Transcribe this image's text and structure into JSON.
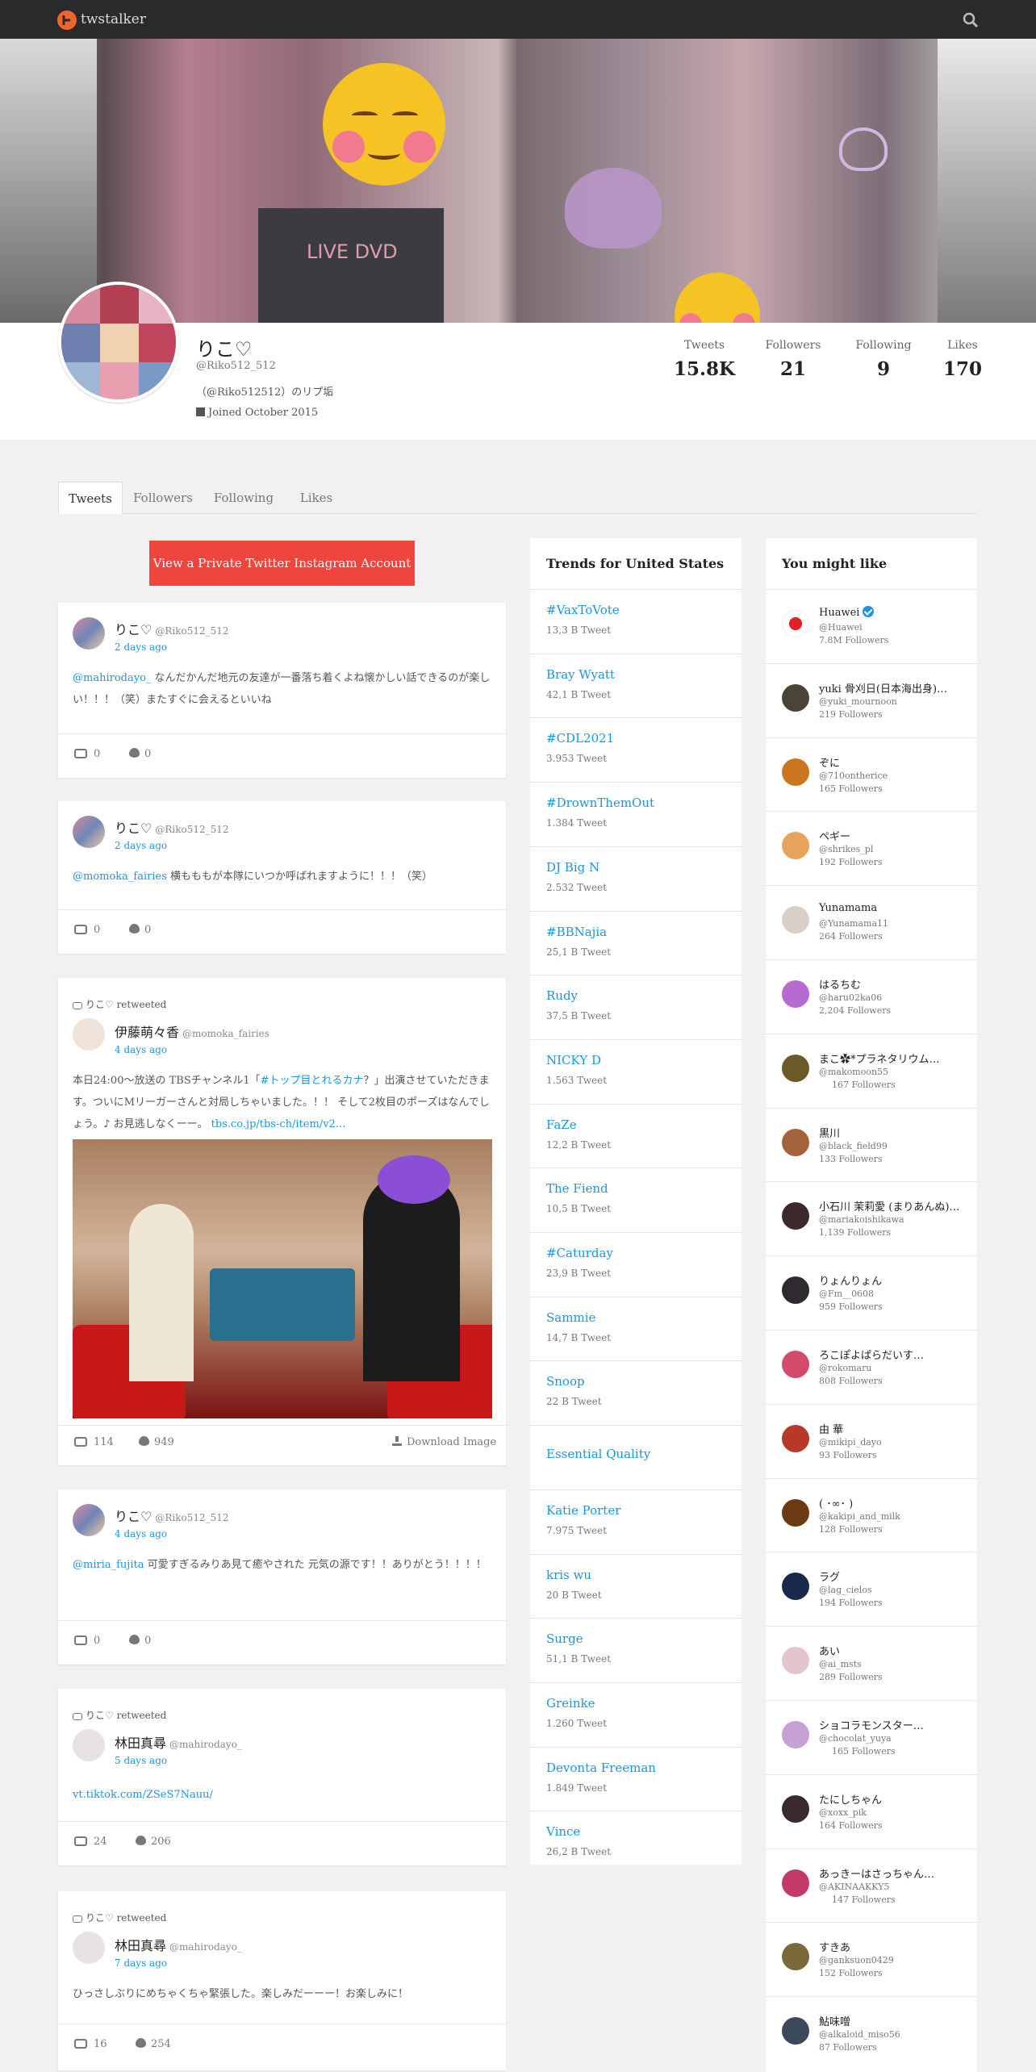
{
  "header": {
    "brand": "twstalker",
    "search_icon": "search-icon",
    "logo_icon": "twstalker-logo-icon"
  },
  "profile": {
    "name": "りこ♡",
    "handle": "@Riko512_512",
    "bio": "（@Riko512512）のリプ垢",
    "joined": "Joined October 2015",
    "stats": [
      {
        "label": "Tweets",
        "value": "15.8K"
      },
      {
        "label": "Followers",
        "value": "21"
      },
      {
        "label": "Following",
        "value": "9"
      },
      {
        "label": "Likes",
        "value": "170"
      }
    ]
  },
  "tabs": [
    "Tweets",
    "Followers",
    "Following",
    "Likes"
  ],
  "active_tab": "Tweets",
  "private_button": "View a Private Twitter Instagram Account",
  "tweets": [
    {
      "retweeted_by": "",
      "name": "りこ♡",
      "handle": "@Riko512_512",
      "time": "2 days ago",
      "mention": "@mahirodayo_",
      "text": "なんだかんだ地元の友達が一番落ち着くよね懐かしい話できるのが楽しい！！！（笑）またすぐに会えるといいね",
      "retweets": "0",
      "likes": "0"
    },
    {
      "retweeted_by": "",
      "name": "りこ♡",
      "handle": "@Riko512_512",
      "time": "2 days ago",
      "mention": "@momoka_fairies",
      "text": "横もももが本隊にいつか呼ばれますように！！！（笑）",
      "retweets": "0",
      "likes": "0"
    },
    {
      "retweeted_by": "りこ♡ retweeted",
      "name": "伊藤萌々香",
      "handle": "@momoka_fairies",
      "time": "4 days ago",
      "text_before": "本日24:00〜放送の TBSチャンネル1「",
      "hashtag": "#トップ目とれるカナ",
      "text_after": "？」出演させていただきます。ついにMリーガーさんと対局しちゃいました。！！ そして2枚目のポーズはなんでしょう。♪ お見逃しなくーー。",
      "link": "tbs.co.jp/tbs-ch/item/v2…",
      "retweets": "114",
      "likes": "949",
      "download": "Download Image"
    },
    {
      "retweeted_by": "",
      "name": "りこ♡",
      "handle": "@Riko512_512",
      "time": "4 days ago",
      "mention": "@miria_fujita",
      "text": "可愛すぎるみりあ見て癒やされた 元気の源です！！ありがとう！！！！",
      "retweets": "0",
      "likes": "0"
    },
    {
      "retweeted_by": "りこ♡ retweeted",
      "name": "林田真尋",
      "handle": "@mahirodayo_",
      "time": "5 days ago",
      "link": "vt.tiktok.com/ZSeS7Nauu/",
      "retweets": "24",
      "likes": "206"
    },
    {
      "retweeted_by": "りこ♡ retweeted",
      "name": "林田真尋",
      "handle": "@mahirodayo_",
      "time": "7 days ago",
      "text": "ひっさしぶりにめちゃくちゃ緊張した。楽しみだーーー！お楽しみに！",
      "retweets": "16",
      "likes": "254"
    }
  ],
  "trends": {
    "title": "Trends for United States",
    "items": [
      {
        "name": "#VaxToVote",
        "count": "13,3 B Tweet"
      },
      {
        "name": "Bray Wyatt",
        "count": "42,1 B Tweet"
      },
      {
        "name": "#CDL2021",
        "count": "3.953 Tweet"
      },
      {
        "name": "#DrownThemOut",
        "count": "1.384 Tweet"
      },
      {
        "name": "DJ Big N",
        "count": "2.532 Tweet"
      },
      {
        "name": "#BBNajia",
        "count": "25,1 B Tweet"
      },
      {
        "name": "Rudy",
        "count": "37,5 B Tweet"
      },
      {
        "name": "NICKY D",
        "count": "1.563 Tweet"
      },
      {
        "name": "FaZe",
        "count": "12,2 B Tweet"
      },
      {
        "name": "The Fiend",
        "count": "10,5 B Tweet"
      },
      {
        "name": "#Caturday",
        "count": "23,9 B Tweet"
      },
      {
        "name": "Sammie",
        "count": "14,7 B Tweet"
      },
      {
        "name": "Snoop",
        "count": "22 B Tweet"
      },
      {
        "name": "Essential Quality",
        "count": ""
      },
      {
        "name": "Katie Porter",
        "count": "7.975 Tweet"
      },
      {
        "name": "kris wu",
        "count": "20 B Tweet"
      },
      {
        "name": "Surge",
        "count": "51,1 B Tweet"
      },
      {
        "name": "Greinke",
        "count": "1.260 Tweet"
      },
      {
        "name": "Devonta Freeman",
        "count": "1.849 Tweet"
      },
      {
        "name": "Vince",
        "count": "26,2 B Tweet"
      }
    ]
  },
  "suggestions": {
    "title": "You might like",
    "items": [
      {
        "name": "Huawei",
        "handle": "@Huawei",
        "followers": "7.8M Followers",
        "verified": true,
        "color": "#ffffff"
      },
      {
        "name": " yuki 骨刈日(日本海出身)…",
        "handle": "@yuki_mournoon",
        "followers": "219 Followers",
        "color": "#4a4438"
      },
      {
        "name": "ぞに",
        "handle": "@710ontherice",
        "followers": "165 Followers",
        "color": "#c9761e"
      },
      {
        "name": "ペギー",
        "handle": "@shrikes_pl",
        "followers": "192 Followers",
        "color": "#e6a35a"
      },
      {
        "name": "Yunamama",
        "handle": "@Yunamama11",
        "followers": "264 Followers",
        "color": "#d8cfc8"
      },
      {
        "name": "はるちむ",
        "handle": "@haru02ka06",
        "followers": "2,204 Followers",
        "color": "#b86ad3"
      },
      {
        "name": "まこ✿*プラネタリウム…",
        "handle": "@makomoon55",
        "followers": "167 Followers",
        "color": "#6a5a2a"
      },
      {
        "name": "黒川",
        "handle": "@black_field99",
        "followers": "133 Followers",
        "color": "#a3623a"
      },
      {
        "name": "小石川 茉莉愛 (まりあんぬ)…",
        "handle": "@mariakoishikawa",
        "followers": "1,139 Followers",
        "color": "#3e2a2a"
      },
      {
        "name": "りょんりょん",
        "handle": "@Fm__0608",
        "followers": "959 Followers",
        "color": "#2e2a30"
      },
      {
        "name": "ろこぽよぱらだいす…",
        "handle": "@rokomaru",
        "followers": "808 Followers",
        "color": "#d34a6a"
      },
      {
        "name": "由 華",
        "handle": "@mikipi_dayo",
        "followers": "93 Followers",
        "color": "#b8382a"
      },
      {
        "name": "( ･∞･ )",
        "handle": "@kakipi_and_milk",
        "followers": "128 Followers",
        "color": "#6b3a12"
      },
      {
        "name": "ラグ",
        "handle": "@lag_cielos",
        "followers": "194 Followers",
        "color": "#1a2a4a"
      },
      {
        "name": "あい",
        "handle": "@ai_msts",
        "followers": "289 Followers",
        "color": "#e3c6cc"
      },
      {
        "name": "ショコラモンスター…",
        "handle": "@chocolat_yuya",
        "followers": "165 Followers",
        "color": "#c7a0d6"
      },
      {
        "name": "たにしちゃん",
        "handle": "@xoxx_pik",
        "followers": "164 Followers",
        "color": "#3a2a2e"
      },
      {
        "name": "あっきーはさっちゃん…",
        "handle": "@AKINAAKKY5",
        "followers": "147 Followers",
        "color": "#c23a6a"
      },
      {
        "name": "すきあ",
        "handle": "@ganksuon0429",
        "followers": "152 Followers",
        "color": "#7a6a3a"
      },
      {
        "name": "鮎味噌",
        "handle": "@alkaloid_miso56",
        "followers": "87 Followers",
        "color": "#3a4a5a"
      }
    ]
  }
}
